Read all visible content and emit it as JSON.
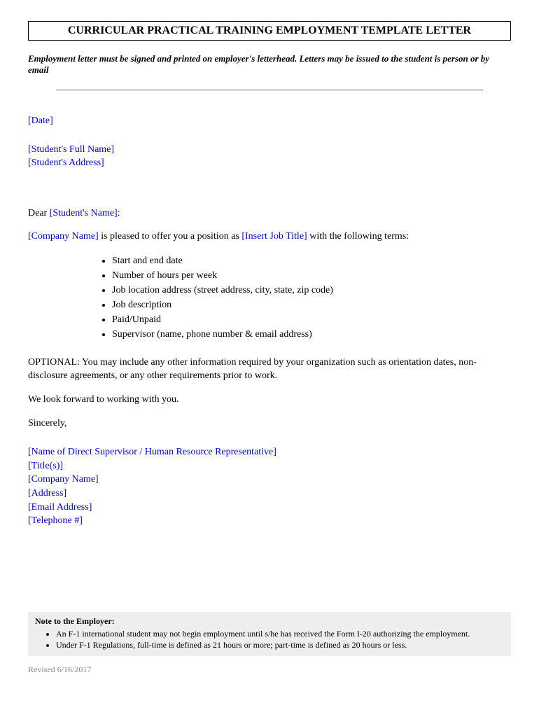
{
  "title": "CURRICULAR PRACTICAL TRAINING EMPLOYMENT TEMPLATE LETTER",
  "instruction": "Employment letter must be signed and printed on employer's letterhead. Letters may be issued to the student is person or by email",
  "placeholders": {
    "date": "[Date]",
    "studentFullName": "[Student's Full Name]",
    "studentAddress": "[Student's Address]",
    "studentName": "[Student's Name]",
    "companyName": "[Company Name]",
    "jobTitle": "[Insert Job Title]"
  },
  "salutationPrefix": "Dear ",
  "salutationSuffix": ":",
  "offerLine": {
    "part1": " is pleased to offer you a position as ",
    "part2": " with the following terms:"
  },
  "terms": [
    "Start and end date",
    "Number of hours per week",
    "Job location address (street address, city, state, zip code)",
    "Job description",
    "Paid/Unpaid",
    "Supervisor (name, phone number & email address)"
  ],
  "optional": "OPTIONAL: You may include any other information required by your organization such as orientation dates, non-disclosure agreements, or any other requirements prior to work.",
  "closing": "We look forward to working with you.",
  "sincerely": "Sincerely,",
  "signature": {
    "supervisor": "[Name of Direct Supervisor / Human Resource Representative]",
    "titles": "[Title(s)]",
    "company": "[Company Name]",
    "address": "[Address]",
    "email": "[Email Address]",
    "telephone": "[Telephone #]"
  },
  "note": {
    "title": "Note to the Employer:",
    "items": [
      "An F-1 international student may not begin employment until s/he has received the Form I-20 authorizing the employment.",
      "Under F-1 Regulations, full-time is defined as 21 hours or more; part-time is defined as 20 hours or less."
    ]
  },
  "revised": "Revised 6/16/2017"
}
